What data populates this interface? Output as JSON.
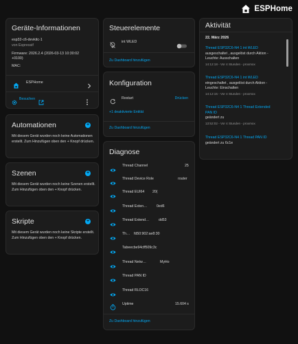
{
  "app": {
    "name": "ESPHome",
    "brand_color": "#ffffff",
    "accent": "#03a9f4"
  },
  "device_info": {
    "title": "Geräte-Informationen",
    "model": "esp32-c6-devkitc-1",
    "manufacturer": "von Espressif",
    "firmware_line1": "Firmware: 2026.2.4 (2026-03-13 10:30:02",
    "firmware_line2": "+0100)",
    "mac_label": "MAC:",
    "integration": "ESPHome",
    "visit_label": "Besuchen"
  },
  "automations": {
    "title": "Automationen",
    "text": "Mit diesem Gerät wurden noch keine Automationen erstellt. Zum Hinzufügen oben den + Knopf drücken."
  },
  "scenes": {
    "title": "Szenen",
    "text": "Mit diesem Gerät wurden noch keine Szenen erstellt. Zum Hinzufügen oben den + Knopf drücken."
  },
  "scripts": {
    "title": "Skripte",
    "text": "Mit diesem Gerät wurden noch keine Skripte erstellt. Zum Hinzufügen oben den + Knopf drücken."
  },
  "controls": {
    "title": "Steuerelemente",
    "item_label": "int WLED",
    "toggle_on": false,
    "add_dashboard": "Zu Dashboard hinzufügen"
  },
  "configuration": {
    "title": "Konfiguration",
    "restart_label": "Restart",
    "restart_action": "Drücken",
    "disabled_entities": "+1 deaktivierte Entität",
    "add_dashboard": "Zu Dashboard hinzufügen"
  },
  "diagnostics": {
    "title": "Diagnose",
    "rows": [
      {
        "name": "Thread Channel",
        "value": "25",
        "icon": "eye-icon"
      },
      {
        "name": "Thread Device Role",
        "value": "router",
        "icon": "eye-icon"
      },
      {
        "name": "Thread EUI64",
        "value": "20(",
        "icon": "eye-icon"
      },
      {
        "name": "Thread Exten…",
        "value": "0ed6",
        "icon": "eye-icon"
      },
      {
        "name": "Thread Extend…",
        "value": "dd53",
        "icon": "eye-icon"
      },
      {
        "name": "Th…",
        "value": "fd50:902:ae8:30",
        "icon": "eye-icon"
      },
      {
        "name": "Tabeecbe94cff509c3c",
        "value": "",
        "icon": "eye-icon"
      },
      {
        "name": "Thread Netw…",
        "value": "MyHo",
        "icon": "eye-icon"
      },
      {
        "name": "Thread PAN ID",
        "value": "",
        "icon": "eye-icon"
      },
      {
        "name": "Thread RLOC16",
        "value": "",
        "icon": "eye-icon"
      },
      {
        "name": "Uptime",
        "value": "15.604 s",
        "icon": "timer-icon"
      }
    ],
    "add_dashboard": "Zu Dashboard hinzufügen"
  },
  "activity": {
    "title": "Aktivität",
    "date": "22. März 2026",
    "entries": [
      {
        "line1": "Thread ESP32C6-N4 1 int WLED",
        "line2": "ausgeschaltet , ausgelöst durch Aktion -",
        "line3": "Leuchte: Ausschalten",
        "meta": "14:12:18 - Vor 4 Stunden - proxmox"
      },
      {
        "line1": "Thread ESP32C6-N4 1 int WLED",
        "line2": "eingeschaltet , ausgelöst durch Aktion -",
        "line3": "Leuchte: Einschalten",
        "meta": "14:12:15 - Vor 4 Stunden - proxmox"
      },
      {
        "line1": "Thread ESP32C6-N4 1 Thread Extended",
        "line2": "PAN ID",
        "line3": "geändert zu",
        "meta": "13:52:02 - Vor 4 Stunden - proxmox"
      },
      {
        "line1": "Thread ESP32C6-N4 1 Thread PAN ID",
        "line2": "geändert zu 6c1e",
        "line3": "",
        "meta": ""
      }
    ]
  }
}
